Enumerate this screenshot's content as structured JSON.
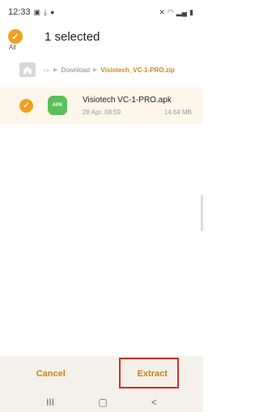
{
  "theme": {
    "accent": "#f2a020",
    "highlight": "#d52b2b"
  },
  "status_bar": {
    "time": "12:33",
    "left_icons": [
      "image-icon",
      "download-icon",
      "circle-icon"
    ],
    "right_icons": [
      "mute-icon",
      "wifi-icon",
      "signal-icon",
      "battery-icon"
    ]
  },
  "header": {
    "all_label": "All",
    "title": "1 selected"
  },
  "breadcrumb": {
    "items": [
      "Download",
      "Visiotech_VC-1-PRO.zip"
    ]
  },
  "files": [
    {
      "icon_label": "APK",
      "name": "Visiotech VC-1-PRO.apk",
      "date": "28 Apr. 08:59",
      "size": "14.64 MB",
      "selected": true
    }
  ],
  "actions": {
    "cancel_label": "Cancel",
    "extract_label": "Extract"
  },
  "nav": {
    "recents_glyph": "III",
    "home_glyph": "▢",
    "back_glyph": "<"
  }
}
